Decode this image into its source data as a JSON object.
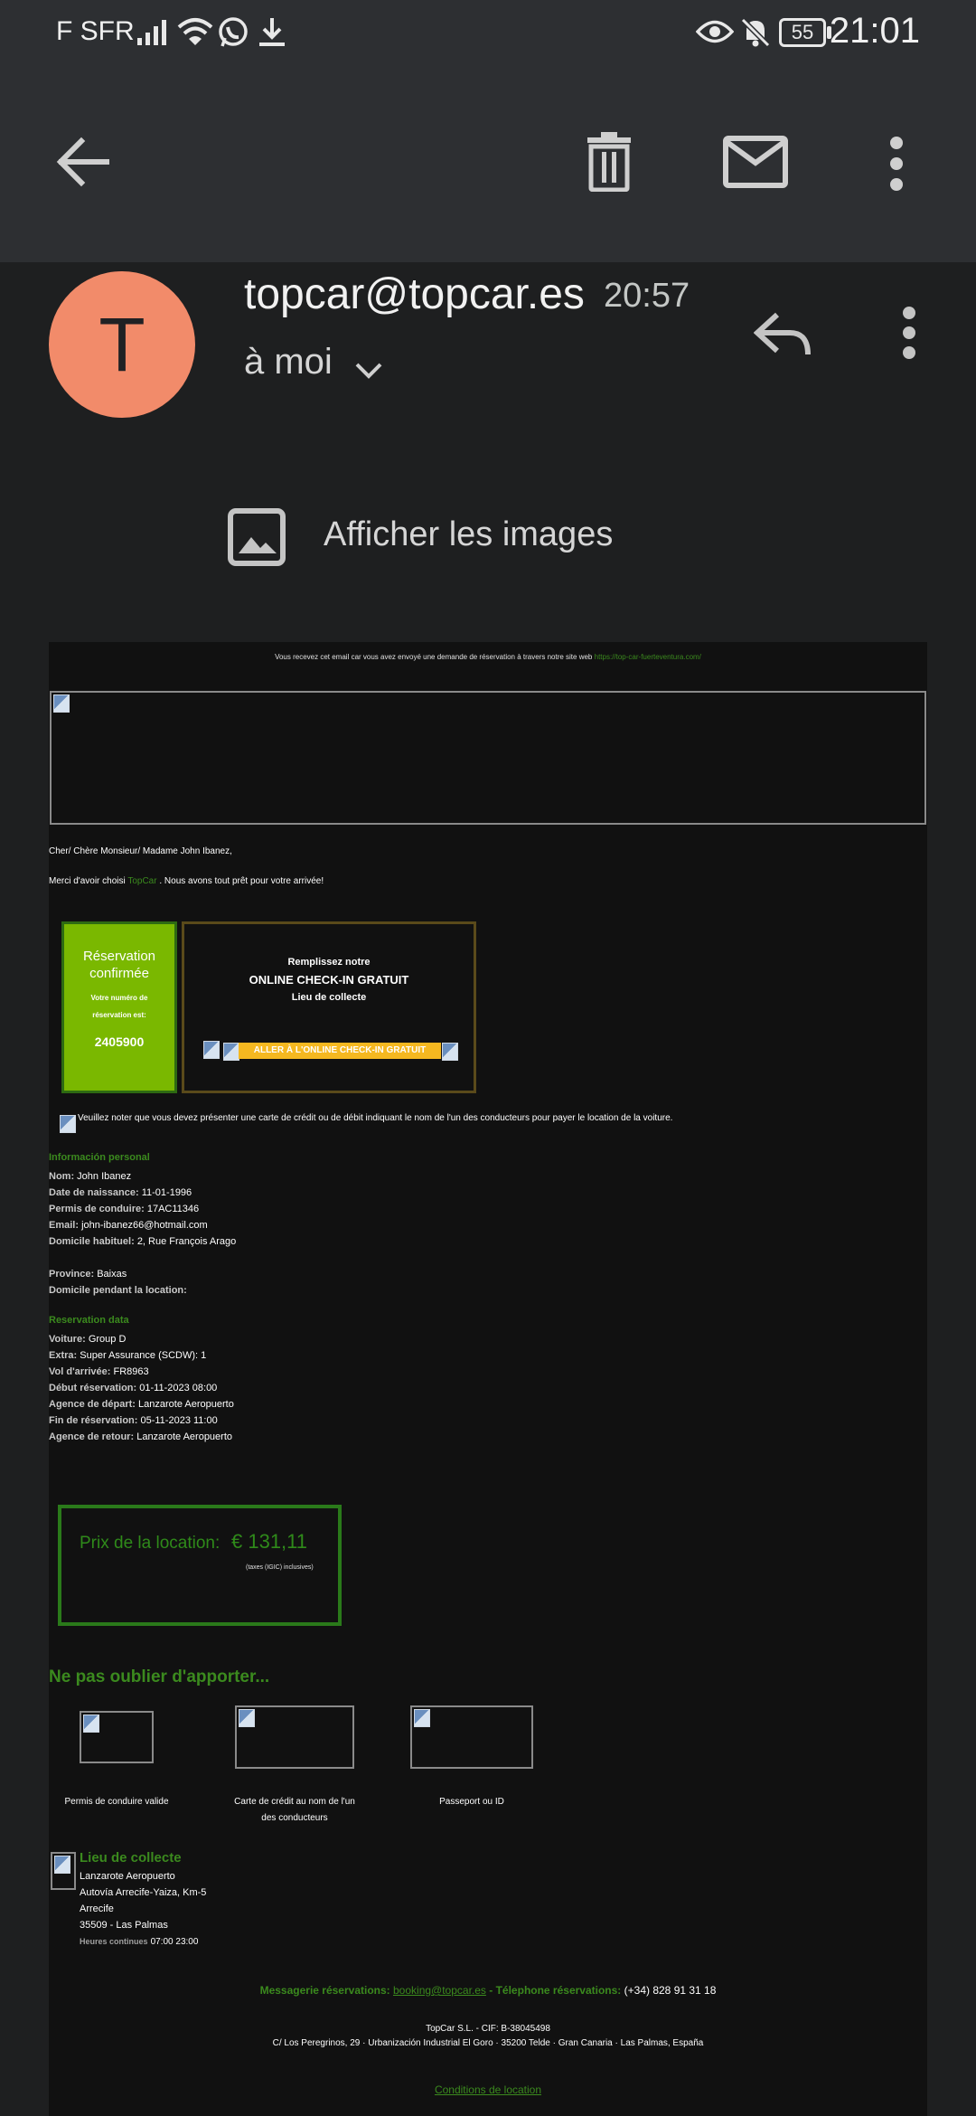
{
  "status_bar": {
    "carrier": "F SFR",
    "battery": "55",
    "time": "21:01"
  },
  "app_bar": {
    "icons": [
      "back-arrow-icon",
      "delete-icon",
      "mark-unread-icon",
      "more-vert-icon"
    ]
  },
  "header": {
    "avatar_letter": "T",
    "avatar_color": "#f28b6a",
    "sender": "topcar@topcar.es",
    "time": "20:57",
    "recipient": "à moi"
  },
  "show_images": {
    "label": "Afficher les images"
  },
  "email": {
    "intro_text": "Vous recevez cet email car vous avez envoyé une demande de réservation à travers notre site web",
    "intro_link": "https://top-car-fuerteventura.com/",
    "greeting": "Cher/ Chère Monsieur/ Madame John Ibanez,",
    "thanks_prefix": "Merci d'avoir choisi",
    "thanks_brand": "TopCar",
    "thanks_suffix": ". Nous avons tout prêt pour votre arrivée!",
    "confirm_box": {
      "title": "Réservation confirmée",
      "subtitle": "Votre numéro de réservation est:",
      "number": "2405900",
      "color": "#7ab800"
    },
    "checkin_box": {
      "line1": "Remplissez notre",
      "line2": "ONLINE CHECK-IN GRATUIT",
      "line3": "Lieu de collecte",
      "button": "ALLER À L'ONLINE CHECK-IN GRATUIT",
      "button_color": "#f5b820"
    },
    "card_notice": "Veuillez noter que vous devez présenter une carte de crédit ou de débit indiquant le nom de l'un des conducteurs pour payer le location de la voiture.",
    "personal": {
      "title": "Información personal",
      "rows": [
        {
          "label": "Nom:",
          "value": "John Ibanez"
        },
        {
          "label": "Date de naissance:",
          "value": "11-01-1996"
        },
        {
          "label": "Permis de conduire:",
          "value": "17AC11346"
        },
        {
          "label": "Email:",
          "value": "john-ibanez66@hotmail.com"
        },
        {
          "label": "Domicile habituel:",
          "value": "2, Rue François Arago"
        },
        {
          "label": "Province:",
          "value": "Baixas"
        },
        {
          "label": "Domicile pendant la location:",
          "value": ""
        }
      ]
    },
    "reservation": {
      "title": "Reservation data",
      "rows": [
        {
          "label": "Voiture:",
          "value": "Group D"
        },
        {
          "label": "Extra:",
          "value": "Super Assurance (SCDW): 1"
        },
        {
          "label": "Vol d'arrivée:",
          "value": "FR8963"
        },
        {
          "label": "Début réservation:",
          "value": "01-11-2023 08:00"
        },
        {
          "label": "Agence de départ:",
          "value": "Lanzarote Aeropuerto"
        },
        {
          "label": "Fin de réservation:",
          "value": "05-11-2023 11:00"
        },
        {
          "label": "Agence de retour:",
          "value": "Lanzarote Aeropuerto"
        }
      ]
    },
    "price": {
      "label": "Prix de la location:",
      "amount": "€ 131,11",
      "note": "(taxes (IGIC) inclusives)"
    },
    "bring": {
      "title": "Ne pas oublier d'apporter...",
      "items": [
        "Permis de conduire valide",
        "Carte de crédit au nom de l'un des conducteurs",
        "Passeport ou ID"
      ]
    },
    "pickup": {
      "title": "Lieu de collecte",
      "lines": [
        "Lanzarote Aeropuerto",
        "Autovía Arrecife-Yaiza, Km-5",
        "Arrecife",
        "35509 - Las Palmas"
      ],
      "hours_label": "Heures continues",
      "hours": "07:00 23:00"
    },
    "footer": {
      "mail_label": "Messagerie réservations:",
      "mail": "booking@topcar.es",
      "phone_label": "- Télephone réservations:",
      "phone": "(+34) 828 91 31 18",
      "company": "TopCar S.L. - CIF: B-38045498",
      "address": "C/ Los Peregrinos, 29 · Urbanización Industrial El Goro · 35200 Telde · Gran Canaria · Las Palmas, España",
      "conditions": "Conditions de location"
    }
  }
}
